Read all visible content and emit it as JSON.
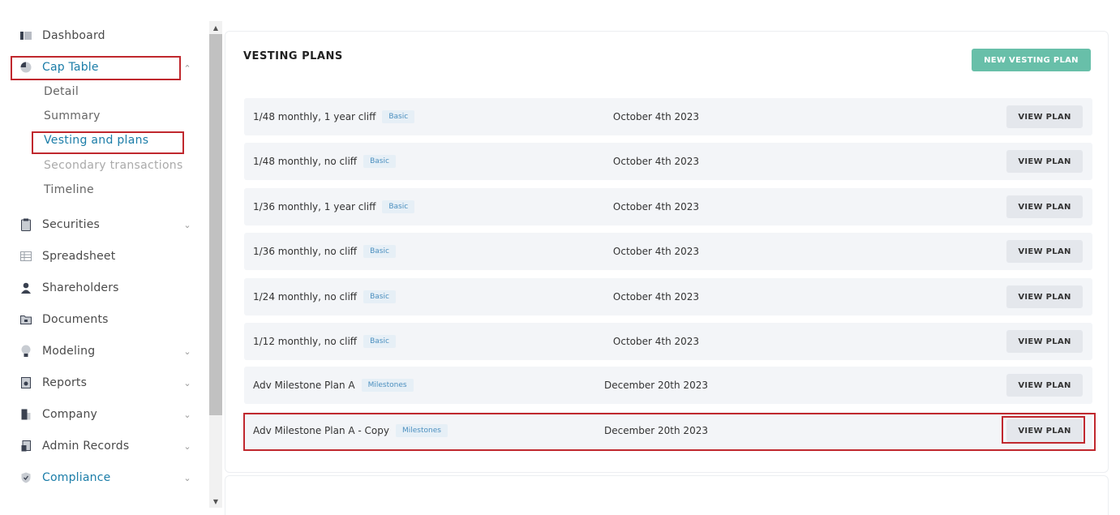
{
  "sidebar": {
    "items": [
      {
        "label": "Dashboard",
        "icon": "dashboard-icon"
      },
      {
        "label": "Cap Table",
        "icon": "pie-chart-icon"
      },
      {
        "label": "Securities",
        "icon": "clipboard-icon"
      },
      {
        "label": "Spreadsheet",
        "icon": "table-icon"
      },
      {
        "label": "Shareholders",
        "icon": "person-icon"
      },
      {
        "label": "Documents",
        "icon": "folder-icon"
      },
      {
        "label": "Modeling",
        "icon": "lightbulb-icon"
      },
      {
        "label": "Reports",
        "icon": "report-icon"
      },
      {
        "label": "Company",
        "icon": "building-icon"
      },
      {
        "label": "Admin Records",
        "icon": "admin-icon"
      },
      {
        "label": "Compliance",
        "icon": "shield-icon"
      }
    ],
    "cap_table_sub": [
      "Detail",
      "Summary",
      "Vesting and plans",
      "Secondary transactions",
      "Timeline"
    ]
  },
  "main": {
    "title": "VESTING PLANS",
    "new_button": "NEW VESTING PLAN",
    "view_label": "VIEW PLAN",
    "plans": [
      {
        "name": "1/48 monthly, 1 year cliff",
        "tag": "Basic",
        "date": "October 4th 2023"
      },
      {
        "name": "1/48 monthly, no cliff",
        "tag": "Basic",
        "date": "October 4th 2023"
      },
      {
        "name": "1/36 monthly, 1 year cliff",
        "tag": "Basic",
        "date": "October 4th 2023"
      },
      {
        "name": "1/36 monthly, no cliff",
        "tag": "Basic",
        "date": "October 4th 2023"
      },
      {
        "name": "1/24 monthly, no cliff",
        "tag": "Basic",
        "date": "October 4th 2023"
      },
      {
        "name": "1/12 monthly, no cliff",
        "tag": "Basic",
        "date": "October 4th 2023"
      },
      {
        "name": "Adv Milestone Plan A",
        "tag": "Milestones",
        "date": "December 20th 2023"
      },
      {
        "name": "Adv Milestone Plan A - Copy",
        "tag": "Milestones",
        "date": "December 20th 2023"
      }
    ]
  },
  "colors": {
    "accent": "#1b7da8",
    "button_green": "#68bfa9",
    "highlight": "#c0282e"
  }
}
